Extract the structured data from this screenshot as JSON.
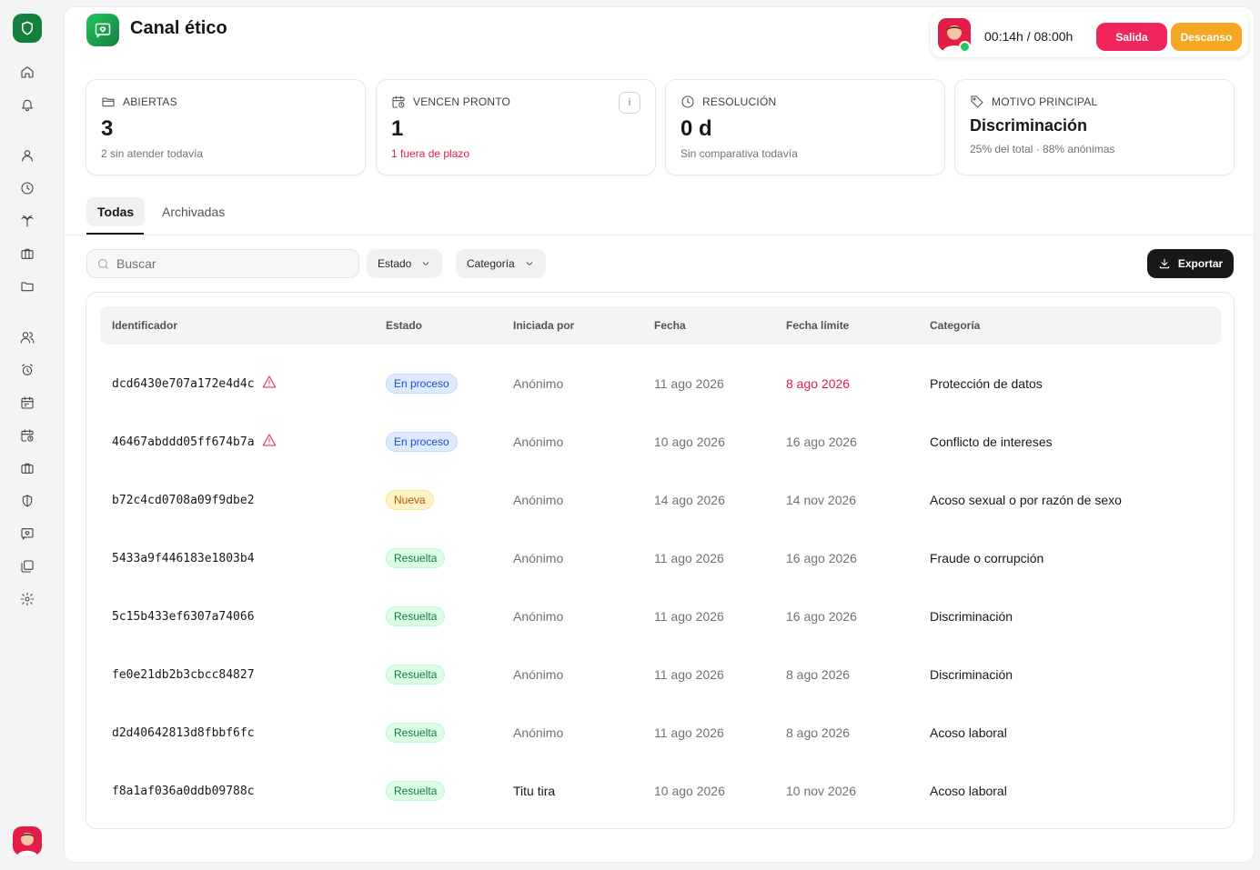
{
  "header": {
    "title": "Canal ético"
  },
  "timer": {
    "elapsed": "00:14h / 08:00h",
    "exit_label": "Salida",
    "break_label": "Descanso"
  },
  "stats": [
    {
      "label": "ABIERTAS",
      "value": "3",
      "sub": "2 sin atender todavía",
      "icon": "folder-open-icon"
    },
    {
      "label": "VENCEN PRONTO",
      "value": "1",
      "sub": "1 fuera de plazo",
      "icon": "calendar-clock-icon",
      "info": "i"
    },
    {
      "label": "RESOLUCIÓN",
      "value": "0 d",
      "sub": "Sin comparativa todavía",
      "icon": "clock-icon"
    },
    {
      "label": "MOTIVO PRINCIPAL",
      "value": "Discriminación",
      "sub": "25% del total · 88% anónimas",
      "icon": "tag-icon"
    }
  ],
  "tabs": [
    {
      "label": "Todas",
      "active": true
    },
    {
      "label": "Archivadas",
      "active": false
    }
  ],
  "filters": {
    "search_placeholder": "Buscar",
    "estado": "Estado",
    "categoria": "Categoría",
    "export_label": "Exportar"
  },
  "table": {
    "columns": [
      "Identificador",
      "Estado",
      "Iniciada por",
      "Fecha",
      "Fecha límite",
      "Categoría"
    ],
    "rows": [
      {
        "id": "dcd6430e707a172e4d4c",
        "warning": true,
        "status": "En proceso",
        "status_type": "proceso",
        "by": "Anónimo",
        "date": "11 ago 2026",
        "due": "8 ago 2026",
        "due_overdue": true,
        "category": "Protección de datos"
      },
      {
        "id": "46467abddd05ff674b7a",
        "warning": true,
        "status": "En proceso",
        "status_type": "proceso",
        "by": "Anónimo",
        "date": "10 ago 2026",
        "due": "16 ago 2026",
        "due_overdue": false,
        "category": "Conflicto de intereses"
      },
      {
        "id": "b72c4cd0708a09f9dbe2",
        "warning": false,
        "status": "Nueva",
        "status_type": "nueva",
        "by": "Anónimo",
        "date": "14 ago 2026",
        "due": "14 nov 2026",
        "due_overdue": false,
        "category": "Acoso sexual o por razón de sexo"
      },
      {
        "id": "5433a9f446183e1803b4",
        "warning": false,
        "status": "Resuelta",
        "status_type": "resuelta",
        "by": "Anónimo",
        "date": "11 ago 2026",
        "due": "16 ago 2026",
        "due_overdue": false,
        "category": "Fraude o corrupción"
      },
      {
        "id": "5c15b433ef6307a74066",
        "warning": false,
        "status": "Resuelta",
        "status_type": "resuelta",
        "by": "Anónimo",
        "date": "11 ago 2026",
        "due": "16 ago 2026",
        "due_overdue": false,
        "category": "Discriminación"
      },
      {
        "id": "fe0e21db2b3cbcc84827",
        "warning": false,
        "status": "Resuelta",
        "status_type": "resuelta",
        "by": "Anónimo",
        "date": "11 ago 2026",
        "due": "8 ago 2026",
        "due_overdue": false,
        "category": "Discriminación"
      },
      {
        "id": "d2d40642813d8fbbf6fc",
        "warning": false,
        "status": "Resuelta",
        "status_type": "resuelta",
        "by": "Anónimo",
        "date": "11 ago 2026",
        "due": "8 ago 2026",
        "due_overdue": false,
        "category": "Acoso laboral"
      },
      {
        "id": "f8a1af036a0ddb09788c",
        "warning": false,
        "status": "Resuelta",
        "status_type": "resuelta",
        "by": "Titu tira",
        "by_named": true,
        "date": "10 ago 2026",
        "due": "10 nov 2026",
        "due_overdue": false,
        "category": "Acoso laboral"
      }
    ]
  },
  "colors": {
    "brand": "#15803d",
    "danger": "#e11d48",
    "break": "#f5a623",
    "exit": "#f0255b"
  },
  "sidebar_icons": [
    "home-icon",
    "bell-icon",
    "user-icon",
    "clock-icon",
    "palm-tree-icon",
    "briefcase-icon",
    "folder-icon",
    "users-icon",
    "alarm-clock-icon",
    "calendar-icon",
    "calendar-clock-icon",
    "building-icon",
    "shield-icon",
    "message-heart-icon",
    "files-icon",
    "settings-icon"
  ]
}
